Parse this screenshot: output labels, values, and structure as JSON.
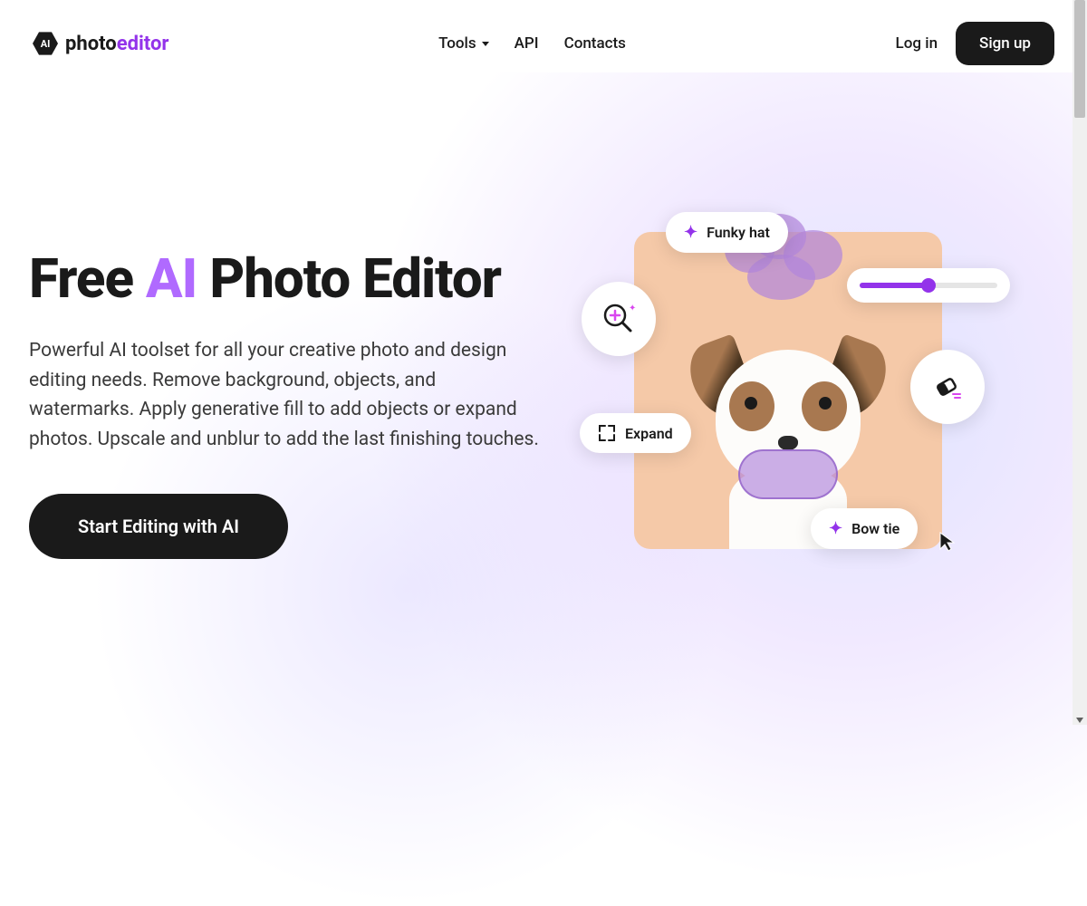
{
  "brand": {
    "badge_text": "AI",
    "name_prefix": "photo",
    "name_accent": "editor"
  },
  "nav": {
    "tools": "Tools",
    "api": "API",
    "contacts": "Contacts",
    "login": "Log in",
    "signup": "Sign up"
  },
  "hero": {
    "title_pre": "Free ",
    "title_accent": "AI ",
    "title_post": "Photo Editor",
    "description": "Powerful AI toolset for all your creative photo and design editing needs. Remove background, objects, and watermarks. Apply generative fill to add objects or expand photos. Upscale and unblur to add the last finishing touches.",
    "cta": "Start Editing with AI"
  },
  "illustration": {
    "pill_funky": "Funky hat",
    "pill_expand": "Expand",
    "pill_bowtie": "Bow tie"
  },
  "colors": {
    "accent_purple": "#9333ea",
    "title_accent": "#b06aff",
    "dark": "#1a1a1a"
  }
}
